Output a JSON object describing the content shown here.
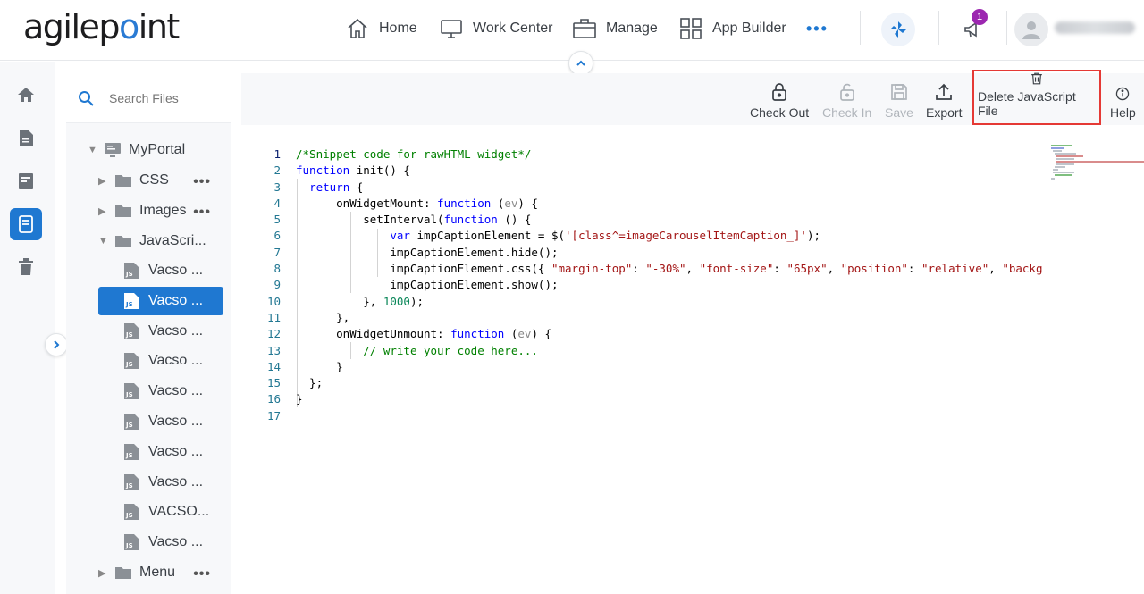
{
  "header": {
    "logo_main": "agilep",
    "logo_dot": "o",
    "logo_end": "int",
    "nav": [
      {
        "label": "Home",
        "icon": "home-icon"
      },
      {
        "label": "Work Center",
        "icon": "monitor-icon"
      },
      {
        "label": "Manage",
        "icon": "briefcase-icon"
      },
      {
        "label": "App Builder",
        "icon": "grid-icon"
      }
    ],
    "more": "•••",
    "notification_count": "1"
  },
  "sidebar": {
    "icons": [
      "home-icon",
      "document-icon",
      "form-icon",
      "page-icon",
      "trash-icon"
    ],
    "active_index": 3
  },
  "tree": {
    "search_placeholder": "Search Files",
    "root": "MyPortal",
    "folders": {
      "css": "CSS",
      "images": "Images",
      "javascript": "JavaScri...",
      "menu": "Menu"
    },
    "more": "•••",
    "files": [
      "Vacso ...",
      "Vacso ...",
      "Vacso ...",
      "Vacso ...",
      "Vacso ...",
      "Vacso ...",
      "Vacso ...",
      "Vacso ...",
      "VACSO...",
      "Vacso ..."
    ],
    "selected_index": 1
  },
  "toolbar": {
    "check_out": "Check Out",
    "check_in": "Check In",
    "save": "Save",
    "export": "Export",
    "delete_js": "Delete JavaScript File",
    "help": "Help"
  },
  "editor": {
    "line_numbers": [
      "1",
      "2",
      "3",
      "4",
      "5",
      "6",
      "7",
      "8",
      "9",
      "10",
      "11",
      "12",
      "13",
      "14",
      "15",
      "16",
      "17"
    ],
    "lines": [
      [
        {
          "t": "/*Snippet code for rawHTML widget*/",
          "c": "c-com"
        }
      ],
      [
        {
          "t": "function",
          "c": "c-kw"
        },
        {
          "t": " init() {",
          "c": ""
        }
      ],
      [
        {
          "t": "  ",
          "c": ""
        },
        {
          "t": "return",
          "c": "c-kw"
        },
        {
          "t": " {",
          "c": ""
        }
      ],
      [
        {
          "t": "      onWidgetMount: ",
          "c": ""
        },
        {
          "t": "function",
          "c": "c-kw"
        },
        {
          "t": " (",
          "c": ""
        },
        {
          "t": "ev",
          "c": "c-par"
        },
        {
          "t": ") {",
          "c": ""
        }
      ],
      [
        {
          "t": "          setInterval(",
          "c": ""
        },
        {
          "t": "function",
          "c": "c-kw"
        },
        {
          "t": " () {",
          "c": ""
        }
      ],
      [
        {
          "t": "              ",
          "c": ""
        },
        {
          "t": "var",
          "c": "c-kw"
        },
        {
          "t": " impCaptionElement = $(",
          "c": ""
        },
        {
          "t": "'[class^=imageCarouselItemCaption_]'",
          "c": "c-str"
        },
        {
          "t": ");",
          "c": ""
        }
      ],
      [
        {
          "t": "              impCaptionElement.hide();",
          "c": ""
        }
      ],
      [
        {
          "t": "              impCaptionElement.css({ ",
          "c": ""
        },
        {
          "t": "\"margin-top\"",
          "c": "c-str"
        },
        {
          "t": ": ",
          "c": ""
        },
        {
          "t": "\"-30%\"",
          "c": "c-str"
        },
        {
          "t": ", ",
          "c": ""
        },
        {
          "t": "\"font-size\"",
          "c": "c-str"
        },
        {
          "t": ": ",
          "c": ""
        },
        {
          "t": "\"65px\"",
          "c": "c-str"
        },
        {
          "t": ", ",
          "c": ""
        },
        {
          "t": "\"position\"",
          "c": "c-str"
        },
        {
          "t": ": ",
          "c": ""
        },
        {
          "t": "\"relative\"",
          "c": "c-str"
        },
        {
          "t": ", ",
          "c": ""
        },
        {
          "t": "\"backgr",
          "c": "c-str"
        }
      ],
      [
        {
          "t": "              impCaptionElement.show();",
          "c": ""
        }
      ],
      [
        {
          "t": "          }, ",
          "c": ""
        },
        {
          "t": "1000",
          "c": "c-num"
        },
        {
          "t": ");",
          "c": ""
        }
      ],
      [
        {
          "t": "      },",
          "c": ""
        }
      ],
      [
        {
          "t": "      onWidgetUnmount: ",
          "c": ""
        },
        {
          "t": "function",
          "c": "c-kw"
        },
        {
          "t": " (",
          "c": ""
        },
        {
          "t": "ev",
          "c": "c-par"
        },
        {
          "t": ") {",
          "c": ""
        }
      ],
      [
        {
          "t": "          ",
          "c": ""
        },
        {
          "t": "// write your code here...",
          "c": "c-com"
        }
      ],
      [
        {
          "t": "      }",
          "c": ""
        }
      ],
      [
        {
          "t": "  };",
          "c": ""
        }
      ],
      [
        {
          "t": "}",
          "c": ""
        }
      ],
      [
        {
          "t": "",
          "c": ""
        }
      ]
    ]
  },
  "colors": {
    "accent": "#1f78d1",
    "highlight_border": "#e53935",
    "badge": "#9c27b0"
  }
}
